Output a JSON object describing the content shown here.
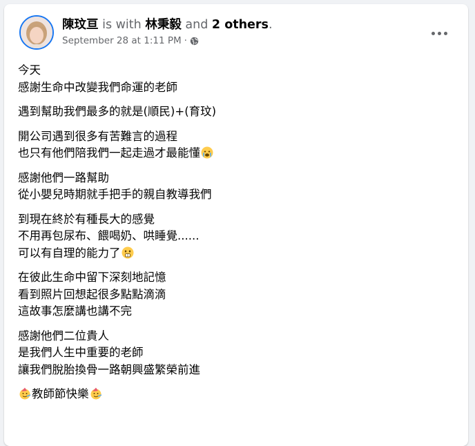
{
  "post": {
    "author": "陳玟亘",
    "with_text": "is with",
    "tagged_name": "林秉毅",
    "and_text": "and",
    "others": "2 others",
    "period": ".",
    "timestamp": "September 28 at 1:11 PM",
    "separator": "·",
    "privacy_icon": "globe-icon",
    "menu_icon": "more-options-icon"
  },
  "paragraphs": [
    [
      "今天",
      "感謝生命中改變我們命運的老師"
    ],
    [
      "遇到幫助我們最多的就是(順民)+(育玟)"
    ],
    [
      "開公司遇到很多有苦難言的過程",
      "也只有他們陪我們一起走過才最能懂"
    ],
    [
      "感謝他們一路幫助",
      "從小嬰兒時期就手把手的親自教導我們"
    ],
    [
      "到現在終於有種長大的感覺",
      "不用再包尿布、餵喝奶、哄睡覺......",
      "可以有自理的能力了"
    ],
    [
      "在彼此生命中留下深刻地記憶",
      "看到照片回想起很多點點滴滴",
      "這故事怎麼講也講不完"
    ],
    [
      "感謝他們二位貴人",
      "是我們人生中重要的老師",
      "讓我們脫胎換骨一路朝興盛繁榮前進"
    ],
    [
      "教師節快樂"
    ]
  ],
  "emoji_names": [
    "crying-face-emoji",
    "hushed-face-emoji",
    "partying-face-emoji"
  ],
  "colors": {
    "link": "#050505",
    "muted": "#65676b",
    "accent": "#1877f2"
  }
}
